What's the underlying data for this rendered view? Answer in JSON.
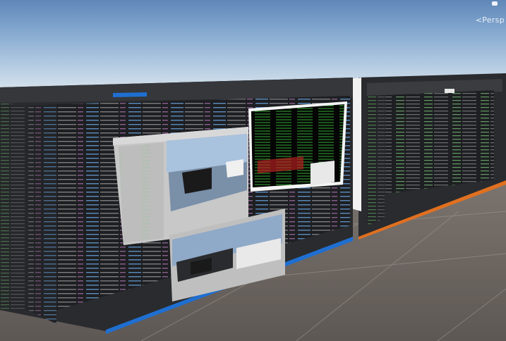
{
  "scene_view": {
    "perspective_label": "<Persp",
    "colors": {
      "sky_top": "#5f87b8",
      "horizon": "#e8eef2",
      "ground": "#77706b",
      "panel_dark": "#2a2b2e",
      "code_bg": "#1e1f22",
      "accent_blue": "#1f6fd1",
      "accent_orange": "#e07020",
      "terminal_bg": "#050505",
      "terminal_text": "#3fd13f"
    }
  }
}
